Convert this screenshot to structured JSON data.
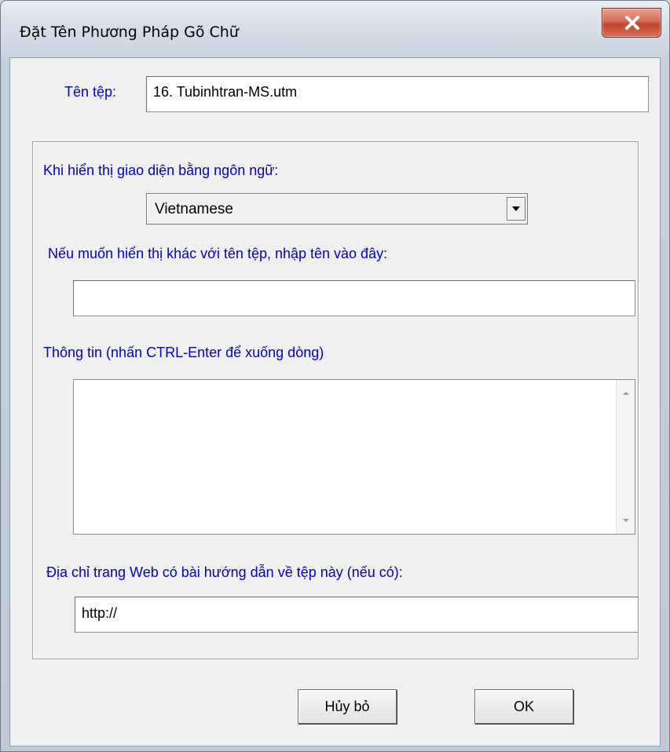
{
  "window": {
    "title": "Đặt Tên Phương Pháp Gõ Chữ"
  },
  "form": {
    "file_name_label": "Tên tệp:",
    "file_name_value": "16. Tubinhtran-MS.utm",
    "language_label": "Khi hiển thị giao diện bằng ngôn ngữ:",
    "language_selected": "Vietnamese",
    "display_name_label": "Nếu muốn hiển thị khác với tên tệp, nhập tên vào đây:",
    "display_name_value": "",
    "info_label": "Thông tin (nhấn CTRL-Enter để xuống dòng)",
    "info_value": "",
    "url_label": "Địa chỉ trang Web có bài hướng dẫn về tệp này (nếu có):",
    "url_value": "http://"
  },
  "buttons": {
    "cancel": "Hủy bỏ",
    "ok": "OK"
  },
  "colors": {
    "label_blue": "#0000cc",
    "close_red": "#c0442c"
  },
  "icons": {
    "close": "close-icon",
    "dropdown": "chevron-down-icon",
    "scroll_up": "scroll-up-arrow-icon",
    "scroll_down": "scroll-down-arrow-icon"
  }
}
